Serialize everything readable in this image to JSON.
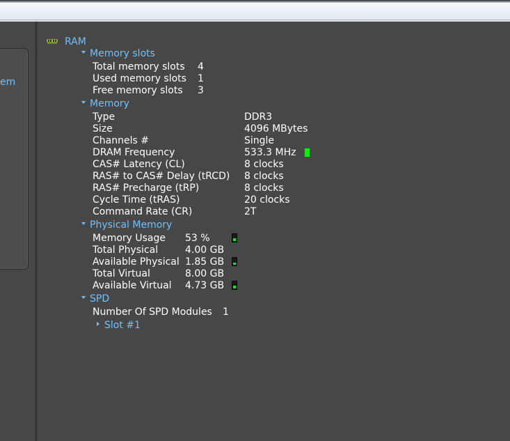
{
  "left_panel": {
    "item_label": "em"
  },
  "tree": {
    "root": {
      "label": "RAM",
      "icon": "ram-module-icon"
    },
    "memory_slots": {
      "label": "Memory slots",
      "rows": [
        {
          "label": "Total memory slots",
          "value": "4"
        },
        {
          "label": "Used memory slots",
          "value": "1"
        },
        {
          "label": "Free memory slots",
          "value": "3"
        }
      ]
    },
    "memory": {
      "label": "Memory",
      "rows": [
        {
          "label": "Type",
          "value": "DDR3"
        },
        {
          "label": "Size",
          "value": "4096 MBytes"
        },
        {
          "label": "Channels #",
          "value": "Single"
        },
        {
          "label": "DRAM Frequency",
          "value": "533.3 MHz"
        },
        {
          "label": "CAS# Latency (CL)",
          "value": "8 clocks"
        },
        {
          "label": "RAS# to CAS# Delay (tRCD)",
          "value": "8 clocks"
        },
        {
          "label": "RAS# Precharge (tRP)",
          "value": "8 clocks"
        },
        {
          "label": "Cycle Time (tRAS)",
          "value": "20 clocks"
        },
        {
          "label": "Command Rate (CR)",
          "value": "2T"
        }
      ]
    },
    "physical_memory": {
      "label": "Physical Memory",
      "rows": [
        {
          "label": "Memory Usage",
          "value": "53 %",
          "gauge_fill": 0.53
        },
        {
          "label": "Total Physical",
          "value": "4.00 GB"
        },
        {
          "label": "Available Physical",
          "value": "1.85 GB",
          "gauge_fill": 0.46
        },
        {
          "label": "Total Virtual",
          "value": "8.00 GB"
        },
        {
          "label": "Available Virtual",
          "value": "4.73 GB",
          "gauge_fill": 0.59
        }
      ]
    },
    "spd": {
      "label": "SPD",
      "rows": [
        {
          "label": "Number Of SPD Modules",
          "value": "1"
        }
      ],
      "slot": {
        "label": "Slot #1"
      }
    }
  },
  "colors": {
    "background": "#474747",
    "accent": "#6fc2ff",
    "gauge": "#19e619",
    "text": "#ffffff"
  }
}
